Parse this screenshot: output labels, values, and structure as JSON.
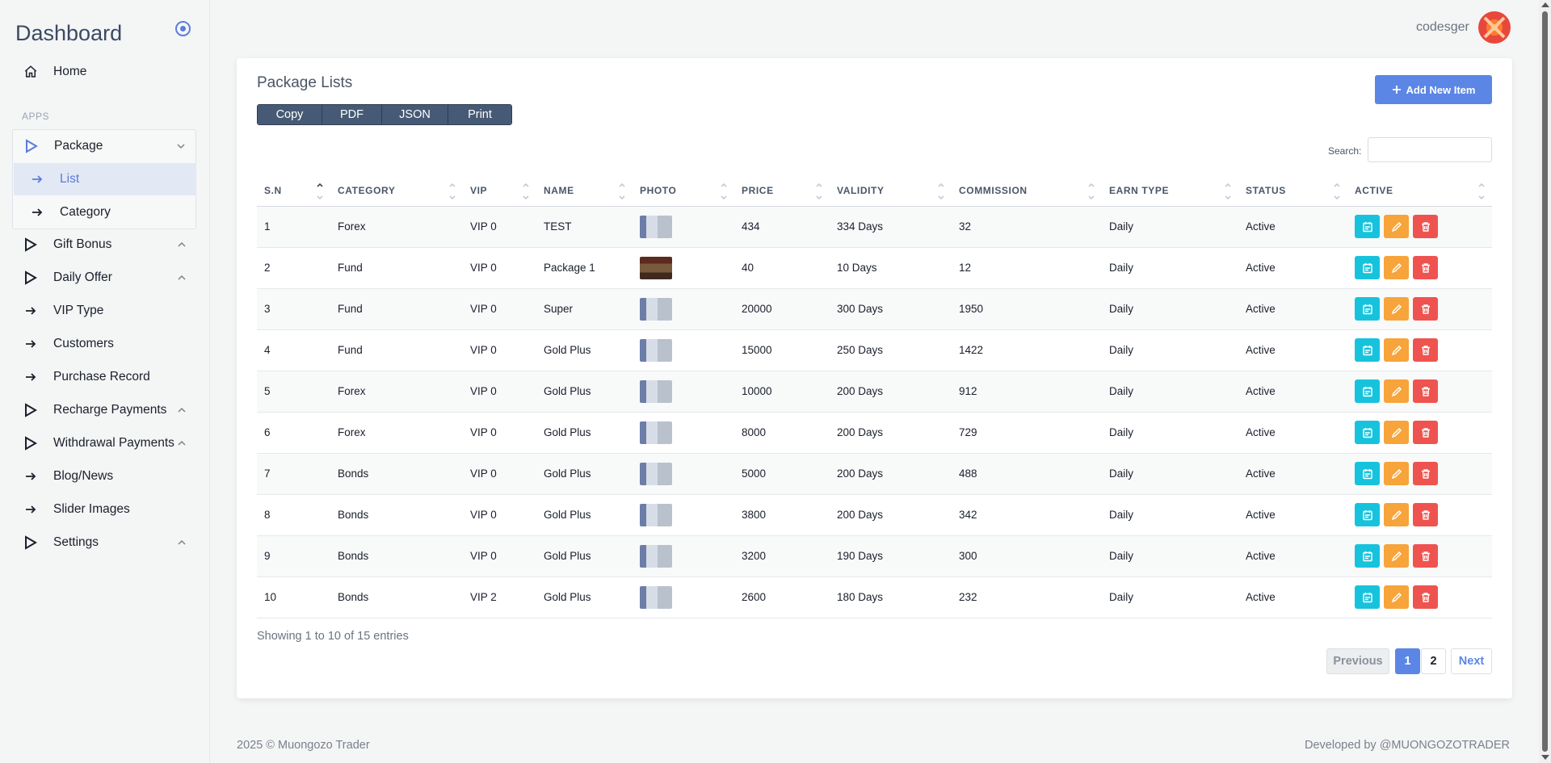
{
  "sidebar": {
    "brand": "Dashboard",
    "section_label": "APPS",
    "items": [
      {
        "label": "Home",
        "icon": "home-icon"
      },
      {
        "label": "Package",
        "icon": "play-outline-icon",
        "expanded": true
      },
      {
        "label": "List",
        "icon": "arrow-right-icon",
        "active": true
      },
      {
        "label": "Category",
        "icon": "arrow-right-icon"
      },
      {
        "label": "Gift Bonus",
        "icon": "play-outline-icon"
      },
      {
        "label": "Daily Offer",
        "icon": "play-outline-icon"
      },
      {
        "label": "VIP Type",
        "icon": "arrow-right-icon"
      },
      {
        "label": "Customers",
        "icon": "arrow-right-icon"
      },
      {
        "label": "Purchase Record",
        "icon": "arrow-right-icon"
      },
      {
        "label": "Recharge Payments",
        "icon": "play-outline-icon"
      },
      {
        "label": "Withdrawal Payments",
        "icon": "play-outline-icon"
      },
      {
        "label": "Blog/News",
        "icon": "arrow-right-icon"
      },
      {
        "label": "Slider Images",
        "icon": "arrow-right-icon"
      },
      {
        "label": "Settings",
        "icon": "play-outline-icon"
      }
    ]
  },
  "topbar": {
    "username": "codesger"
  },
  "card": {
    "title": "Package Lists",
    "export_buttons": [
      "Copy",
      "PDF",
      "JSON",
      "Print"
    ],
    "add_button": "Add New Item",
    "search_label": "Search:",
    "search_value": ""
  },
  "table": {
    "columns": [
      "S.N",
      "CATEGORY",
      "VIP",
      "NAME",
      "PHOTO",
      "PRICE",
      "VALIDITY",
      "COMMISSION",
      "EARN TYPE",
      "STATUS",
      "ACTIVE"
    ],
    "rows": [
      [
        "1",
        "Forex",
        "VIP 0",
        "TEST",
        "",
        "434",
        "334 Days",
        "32",
        "Daily",
        "Active"
      ],
      [
        "2",
        "Fund",
        "VIP 0",
        "Package 1",
        "",
        "40",
        "10 Days",
        "12",
        "Daily",
        "Active"
      ],
      [
        "3",
        "Fund",
        "VIP 0",
        "Super",
        "",
        "20000",
        "300 Days",
        "1950",
        "Daily",
        "Active"
      ],
      [
        "4",
        "Fund",
        "VIP 0",
        "Gold Plus",
        "",
        "15000",
        "250 Days",
        "1422",
        "Daily",
        "Active"
      ],
      [
        "5",
        "Forex",
        "VIP 0",
        "Gold Plus",
        "",
        "10000",
        "200 Days",
        "912",
        "Daily",
        "Active"
      ],
      [
        "6",
        "Forex",
        "VIP 0",
        "Gold Plus",
        "",
        "8000",
        "200 Days",
        "729",
        "Daily",
        "Active"
      ],
      [
        "7",
        "Bonds",
        "VIP 0",
        "Gold Plus",
        "",
        "5000",
        "200 Days",
        "488",
        "Daily",
        "Active"
      ],
      [
        "8",
        "Bonds",
        "VIP 0",
        "Gold Plus",
        "",
        "3800",
        "200 Days",
        "342",
        "Daily",
        "Active"
      ],
      [
        "9",
        "Bonds",
        "VIP 0",
        "Gold Plus",
        "",
        "3200",
        "190 Days",
        "300",
        "Daily",
        "Active"
      ],
      [
        "10",
        "Bonds",
        "VIP 2",
        "Gold Plus",
        "",
        "2600",
        "180 Days",
        "232",
        "Daily",
        "Active"
      ]
    ]
  },
  "pagination": {
    "info": "Showing 1 to 10 of 15 entries",
    "previous": "Previous",
    "pages": [
      "1",
      "2"
    ],
    "current": "1",
    "next": "Next"
  },
  "footer": {
    "copyright": "2025 © Muongozo Trader",
    "developed_by": "Developed by  @MUONGOZOTRADER"
  },
  "colors": {
    "accent": "#5b86e5",
    "view_button": "#17c3dc",
    "edit_button": "#f7a43a",
    "delete_button": "#ef5350",
    "export_buttons": "#465a75"
  }
}
